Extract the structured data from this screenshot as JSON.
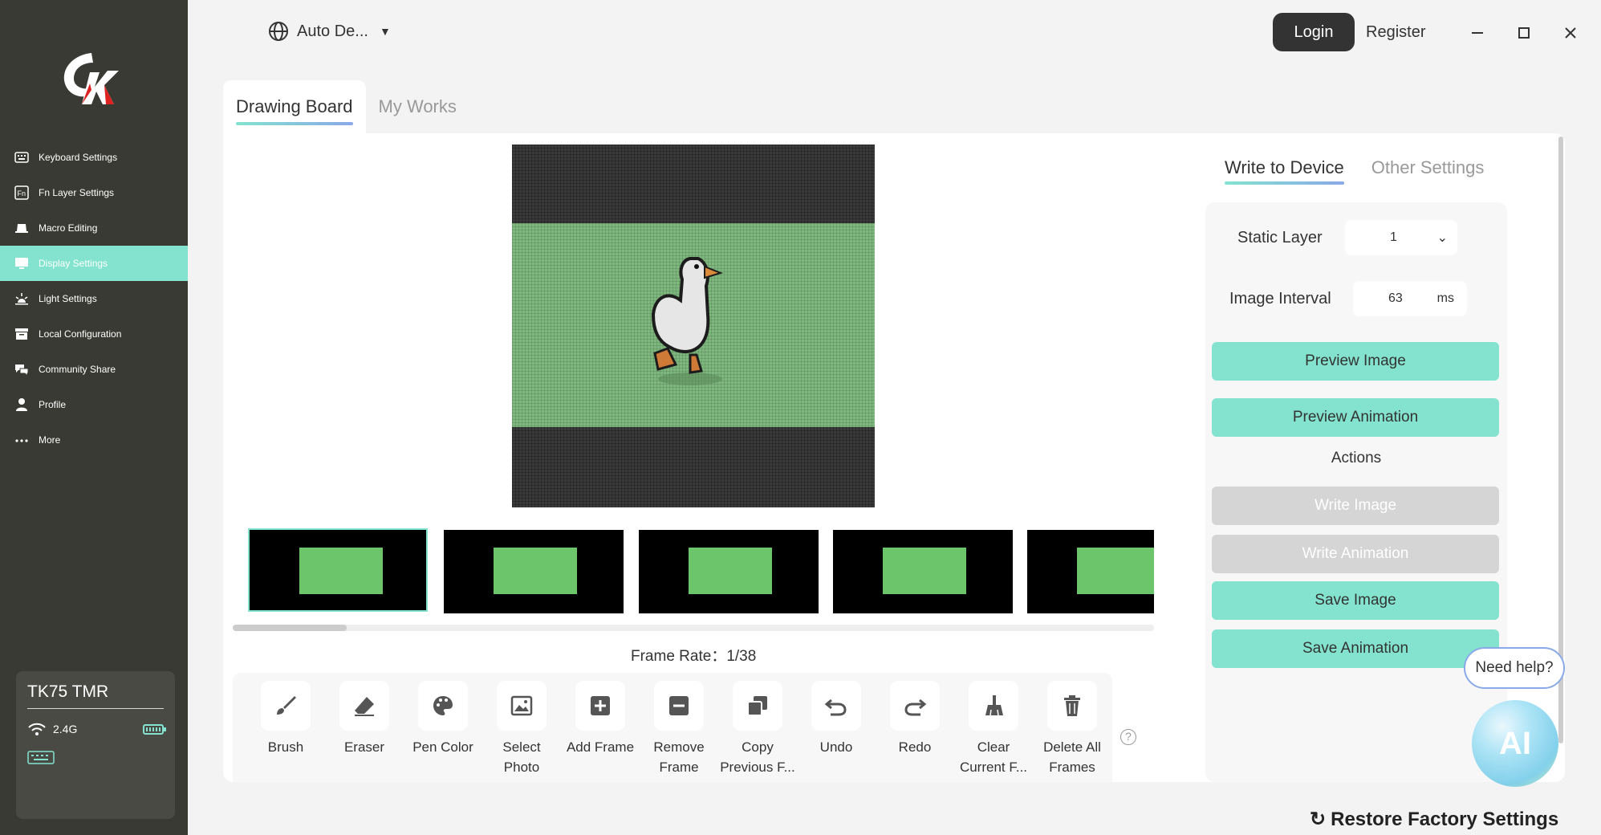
{
  "sidebar": {
    "items": [
      {
        "label": "Keyboard Settings",
        "icon": "keyboard-icon"
      },
      {
        "label": "Fn Layer Settings",
        "icon": "fn-icon"
      },
      {
        "label": "Macro Editing",
        "icon": "macro-icon"
      },
      {
        "label": "Display Settings",
        "icon": "display-icon"
      },
      {
        "label": "Light Settings",
        "icon": "light-icon"
      },
      {
        "label": "Local Configuration",
        "icon": "archive-icon"
      },
      {
        "label": "Community Share",
        "icon": "chat-icon"
      },
      {
        "label": "Profile",
        "icon": "user-icon"
      },
      {
        "label": "More",
        "icon": "more-icon"
      }
    ],
    "active_index": 3,
    "device": {
      "name": "TK75 TMR",
      "connection": "2.4G"
    }
  },
  "topbar": {
    "language": "Auto De...",
    "login": "Login",
    "register": "Register"
  },
  "main": {
    "tabs": [
      {
        "label": "Drawing Board"
      },
      {
        "label": "My Works"
      }
    ],
    "frame_rate_label": "Frame Rate：",
    "frame_rate_value": "1/38",
    "tools": [
      {
        "label": "Brush",
        "icon": "brush-icon"
      },
      {
        "label": "Eraser",
        "icon": "eraser-icon"
      },
      {
        "label": "Pen Color",
        "icon": "palette-icon"
      },
      {
        "label": "Select Photo",
        "icon": "image-icon"
      },
      {
        "label": "Add Frame",
        "icon": "plus-icon"
      },
      {
        "label": "Remove Frame",
        "icon": "minus-icon"
      },
      {
        "label": "Copy Previous F...",
        "icon": "copy-icon"
      },
      {
        "label": "Undo",
        "icon": "undo-icon"
      },
      {
        "label": "Redo",
        "icon": "redo-icon"
      },
      {
        "label": "Clear Current F...",
        "icon": "broom-icon"
      },
      {
        "label": "Delete All Frames",
        "icon": "trash-icon"
      }
    ]
  },
  "right": {
    "tabs": [
      {
        "label": "Write to Device"
      },
      {
        "label": "Other Settings"
      }
    ],
    "static_layer_label": "Static Layer",
    "static_layer_value": "1",
    "image_interval_label": "Image Interval",
    "image_interval_value": "63",
    "image_interval_unit": "ms",
    "preview_image": "Preview Image",
    "preview_animation": "Preview Animation",
    "actions_label": "Actions",
    "write_image": "Write Image",
    "write_animation": "Write Animation",
    "save_image": "Save Image",
    "save_animation": "Save Animation"
  },
  "help": {
    "need_help": "Need help?",
    "ai": "AI"
  },
  "restore": "Restore Factory Settings",
  "colors": {
    "accent": "#83e3cf",
    "sidebar": "#3a3a34",
    "canvas_green": "#7fb87e"
  }
}
